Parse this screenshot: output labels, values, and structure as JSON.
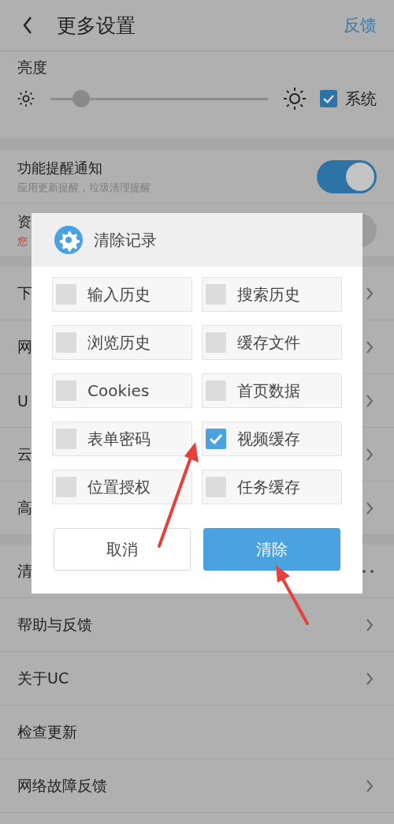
{
  "header": {
    "title": "更多设置",
    "action": "反馈"
  },
  "brightness": {
    "label": "亮度",
    "level": 0.14,
    "system": {
      "label": "系统",
      "checked": true
    }
  },
  "toggles": [
    {
      "title": "功能提醒通知",
      "subtitle": "应用更新提醒，垃圾清理提醒",
      "subtitle_alert": false,
      "on": true
    },
    {
      "title": "资",
      "subtitle": "您",
      "subtitle_alert": true,
      "on": false
    }
  ],
  "menu_groups": [
    [
      {
        "label": "下",
        "kind": "chevron"
      },
      {
        "label": "网",
        "kind": "chevron"
      },
      {
        "label": "U",
        "kind": "chevron"
      },
      {
        "label": "云",
        "kind": "chevron"
      },
      {
        "label": "高",
        "kind": "chevron"
      }
    ],
    [
      {
        "label": "清",
        "kind": "dots"
      },
      {
        "label": "帮助与反馈",
        "kind": "chevron"
      },
      {
        "label": "关于UC",
        "kind": "chevron"
      },
      {
        "label": "检查更新",
        "kind": "plain"
      },
      {
        "label": "网络故障反馈",
        "kind": "chevron"
      }
    ]
  ],
  "dialog": {
    "title": "清除记录",
    "options": [
      {
        "label": "输入历史",
        "checked": false
      },
      {
        "label": "搜索历史",
        "checked": false
      },
      {
        "label": "浏览历史",
        "checked": false
      },
      {
        "label": "缓存文件",
        "checked": false
      },
      {
        "label": "Cookies",
        "checked": false
      },
      {
        "label": "首页数据",
        "checked": false
      },
      {
        "label": "表单密码",
        "checked": false
      },
      {
        "label": "视频缓存",
        "checked": true
      },
      {
        "label": "位置授权",
        "checked": false
      },
      {
        "label": "任务缓存",
        "checked": false
      }
    ],
    "buttons": [
      {
        "label": "取消",
        "kind": "secondary"
      },
      {
        "label": "清除",
        "kind": "primary"
      }
    ]
  }
}
